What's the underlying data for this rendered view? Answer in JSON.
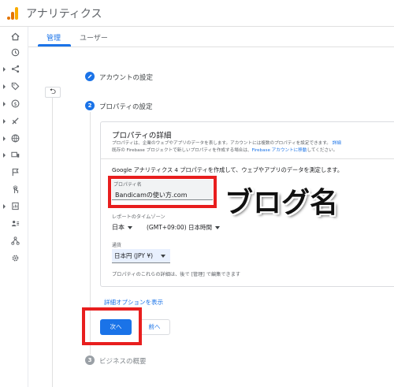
{
  "header": {
    "title": "アナリティクス"
  },
  "tabs": [
    {
      "label": "管理"
    },
    {
      "label": "ユーザー"
    }
  ],
  "back_button": {
    "label": "⮌"
  },
  "steps": [
    {
      "label": "アカウントの設定"
    },
    {
      "label": "プロパティの設定",
      "number": "2"
    },
    {
      "label": "ビジネスの概要",
      "number": "3"
    }
  ],
  "card": {
    "title": "プロパティの詳細",
    "desc_line1": "プロパティは、企業のウェブやアプリのデータを表します。アカウントには複数のプロパティを設定できます。",
    "desc_line1_link": "詳細",
    "desc_line2_pre": "既存の Firebase プロジェクトで新しいプロパティを作成する場合は、",
    "desc_line2_link": "Firebase アカウントに移動",
    "desc_line2_post": "してください。",
    "intro": "Google アナリティクス 4 プロパティを作成して、ウェブやアプリのデータを測定します。",
    "property_name_label": "プロパティ名",
    "property_name_value": "Bandicamの使い方.com",
    "timezone_label": "レポートのタイムゾーン",
    "timezone_country": "日本",
    "timezone_value": "(GMT+09:00) 日本時間",
    "currency_label": "通貨",
    "currency_value": "日本円 (JPY ¥)",
    "footnote": "プロパティのこれらの詳細は、後で [管理] で編集できます"
  },
  "advanced_link": "詳細オプションを表示",
  "buttons": {
    "next": "次へ",
    "prev": "前へ"
  },
  "annotation": "ブログ名",
  "colors": {
    "accent": "#1a73e8",
    "highlight": "#e81e1e",
    "logo_orange": "#f9ab00",
    "logo_dark": "#e37400"
  }
}
